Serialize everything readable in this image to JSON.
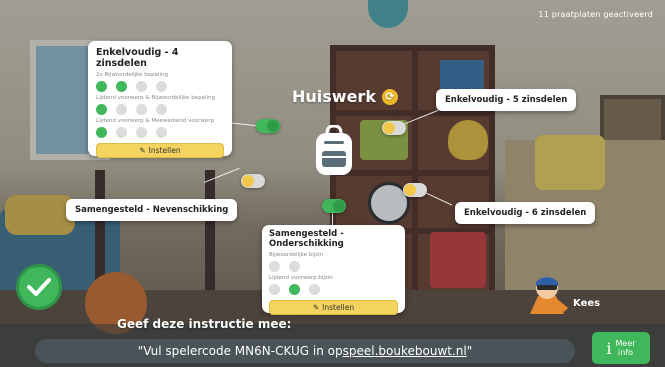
{
  "status": {
    "activated_text": "11 praatplaten geactiveerd"
  },
  "center": {
    "title": "Huiswerk"
  },
  "panels": {
    "enkelvoudig4": {
      "title": "Enkelvoudig - 4 zinsdelen",
      "rules": [
        {
          "label": "2x Bijwoordelijke bepaling",
          "dots": [
            true,
            true,
            false,
            false
          ]
        },
        {
          "label": "Lijdend voorwerp & Bijwoordelijke bepaling",
          "dots": [
            true,
            false,
            false,
            false
          ]
        },
        {
          "label": "Lijdend voorwerp & Meewerkend voorwerp",
          "dots": [
            true,
            false,
            false,
            false
          ]
        }
      ],
      "button": "Instellen",
      "enabled": true
    },
    "onderschikking": {
      "title": "Samengesteld - Onderschikking",
      "rules": [
        {
          "label": "Bijwoordelijke bijzin",
          "dots": [
            false,
            false
          ]
        },
        {
          "label": "Lijdend voorwerp bijzin",
          "dots": [
            false,
            true,
            false
          ]
        }
      ],
      "button": "Instellen",
      "enabled": true
    }
  },
  "pills": {
    "enkelvoudig5": {
      "label": "Enkelvoudig - 5 zinsdelen",
      "enabled": false
    },
    "enkelvoudig6": {
      "label": "Enkelvoudig - 6 zinsdelen",
      "enabled": false
    },
    "nevenschikking": {
      "label": "Samengesteld - Nevenschikking",
      "enabled": false
    }
  },
  "user": {
    "name": "Kees"
  },
  "instruction": {
    "label": "Geef deze instructie mee:",
    "prefix": "\"Vul spelercode MN6N-CKUG in op ",
    "link": "speel.boukebouwt.nl",
    "suffix": "\""
  },
  "more_info": {
    "label_line1": "Meer",
    "label_line2": "info"
  },
  "colors": {
    "accent_green": "#3fb75a",
    "accent_yellow": "#f4d35e"
  }
}
